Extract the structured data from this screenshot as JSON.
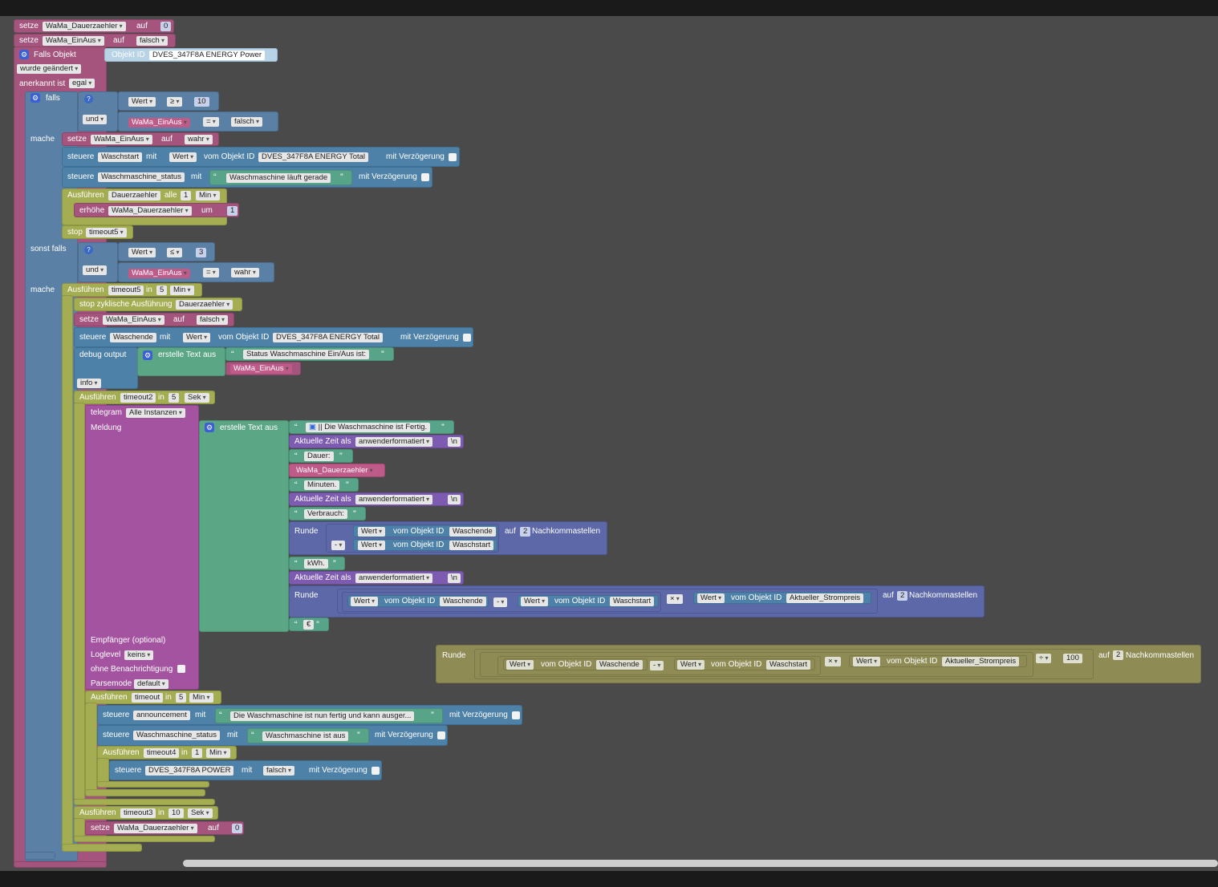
{
  "kw": {
    "setze": "setze",
    "auf": "auf",
    "falls_objekt": "Falls Objekt",
    "objekt_id": "Objekt ID",
    "anerkannt_ist": "anerkannt ist",
    "falls": "falls",
    "und": "und",
    "mache": "mache",
    "steuere": "steuere",
    "mit": "mit",
    "vom_objekt_id": "vom Objekt ID",
    "mit_verzoegerung": "mit Verzögerung",
    "ausfuehren": "Ausführen",
    "alle": "alle",
    "erhoehe": "erhöhe",
    "um": "um",
    "stop": "stop",
    "sonst_falls": "sonst falls",
    "in": "in",
    "stop_zyklisch": "stop zyklische Ausführung",
    "debug_output": "debug output",
    "erstelle_text_aus": "erstelle Text aus",
    "telegram": "telegram",
    "meldung": "Meldung",
    "aktuelle_zeit_als": "Aktuelle Zeit als",
    "runde": "Runde",
    "nachkommastellen": "Nachkommastellen",
    "empfaenger": "Empfänger (optional)",
    "loglevel": "Loglevel",
    "ohne_benachrichtigung": "ohne Benachrichtigung",
    "parsemode": "Parsemode",
    "newline": "\\n"
  },
  "vars": {
    "dauer": "WaMa_Dauerzaehler",
    "einaus": "WaMa_EinAus"
  },
  "values": {
    "zero": "0",
    "one": "1",
    "two": "2",
    "three": "3",
    "five": "5",
    "ten": "10",
    "hundred": "100",
    "falsch": "falsch",
    "wahr": "wahr",
    "egal": "egal",
    "wurde_geaendert": "wurde geändert",
    "wert": "Wert",
    "ge": "≥",
    "le": "≤",
    "eq": "=",
    "minus": "-",
    "times": "×",
    "div": "÷",
    "min": "Min",
    "sek": "Sek",
    "info": "info",
    "anwenderformatiert": "anwenderformatiert",
    "alle_instanzen": "Alle Instanzen",
    "keins": "keins",
    "default": "default"
  },
  "ids": {
    "power": "DVES_347F8A ENERGY  Power",
    "total": "DVES_347F8A ENERGY  Total",
    "power_out": "DVES_347F8A POWER",
    "waschstart": "Waschstart",
    "waschende": "Waschende",
    "status": "Waschmaschine_status",
    "announcement": "announcement",
    "strompreis": "Aktueller_Strompreis"
  },
  "timers": {
    "dauer": "Dauerzaehler",
    "timeout5": "timeout5",
    "timeout2": "timeout2",
    "timeout": "timeout",
    "timeout4": "timeout4",
    "timeout3": "timeout3"
  },
  "strings": {
    "laeuft": "Waschmaschine läuft gerade",
    "status_einaus": "Status Waschmaschine Ein/Aus ist:",
    "fertig": "|| Die Waschmaschine ist Fertig.",
    "dauer": "Dauer:",
    "minuten": "Minuten.",
    "verbrauch": "Verbrauch:",
    "kwh": "kWh.",
    "euro": "€",
    "announce": "Die Waschmaschine ist nun fertig und kann ausger...",
    "ist_aus": "Waschmaschine ist aus"
  },
  "colors": {
    "workspace": "#4a4a4a",
    "variable": "#a5557d",
    "control": "#5b80a5",
    "timer": "#a5ad52",
    "text": "#58a488",
    "telegram": "#a3539f",
    "math": "#5c68a8",
    "time": "#7d5bb0"
  }
}
